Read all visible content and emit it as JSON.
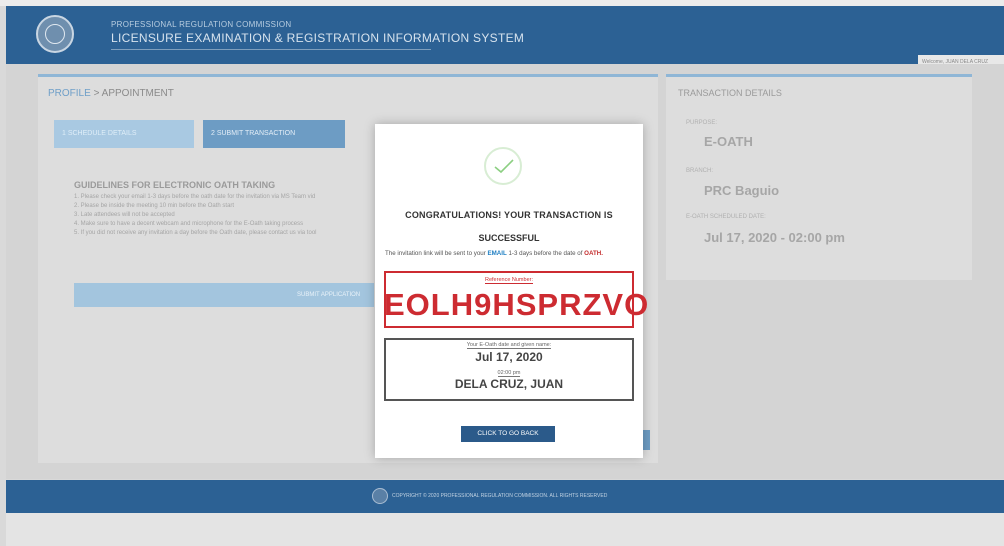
{
  "header": {
    "org": "PROFESSIONAL REGULATION COMMISSION",
    "system": "LICENSURE EXAMINATION & REGISTRATION INFORMATION SYSTEM",
    "welcome": "Welcome, JUAN DELA CRUZ",
    "seal_icon": "prc-seal-icon"
  },
  "breadcrumb": {
    "link": "PROFILE",
    "separator": " > ",
    "current": "APPOINTMENT"
  },
  "steps": [
    "1  SCHEDULE DETAILS",
    "2  SUBMIT TRANSACTION"
  ],
  "guidelines": {
    "title": "GUIDELINES FOR ELECTRONIC OATH TAKING",
    "items": [
      "1. Please check your email 1-3 days before the oath date for the invitation via MS Team vid",
      "2. Please be inside the meeting 10 min before the Oath start",
      "3. Late attendees will not be accepted",
      "4. Make sure to have a decent webcam and microphone for the E-Oath taking process",
      "5. If you did not receive any invitation a day before the Oath date, please contact us via tool"
    ]
  },
  "submit_label": "SUBMIT APPLICATION",
  "transaction": {
    "title": "TRANSACTION DETAILS",
    "purpose_label": "PURPOSE:",
    "purpose": "E-OATH",
    "branch_label": "BRANCH:",
    "branch": "PRC Baguio",
    "sched_label": "E-OATH SCHEDULED DATE:",
    "sched": "Jul 17, 2020 - 02:00 pm"
  },
  "modal": {
    "heading1": "CONGRATULATIONS! YOUR TRANSACTION IS",
    "heading2": "SUCCESSFUL",
    "note_pre": "The invitation link will be sent to your ",
    "note_email": "EMAIL",
    "note_mid": " 1-3 days before the date of ",
    "note_oath": "OATH.",
    "ref_label": "Reference Number:",
    "ref_code": "EOLH9HSPRZVO",
    "date_label": "Your E-Oath date and given name:",
    "date": "Jul 17, 2020",
    "time": "02:00 pm",
    "name": "DELA CRUZ, JUAN",
    "button": "CLICK TO GO BACK",
    "icon": "checkmark-circle-icon"
  },
  "footer": {
    "text": "COPYRIGHT © 2020 PROFESSIONAL REGULATION COMMISSION. ALL RIGHTS RESERVED"
  },
  "colors": {
    "header": "#2c6194",
    "accent_red": "#cd2b31",
    "email_blue": "#1f7fc3",
    "button": "#2b5a8a",
    "check_green": "#8ccf82"
  }
}
